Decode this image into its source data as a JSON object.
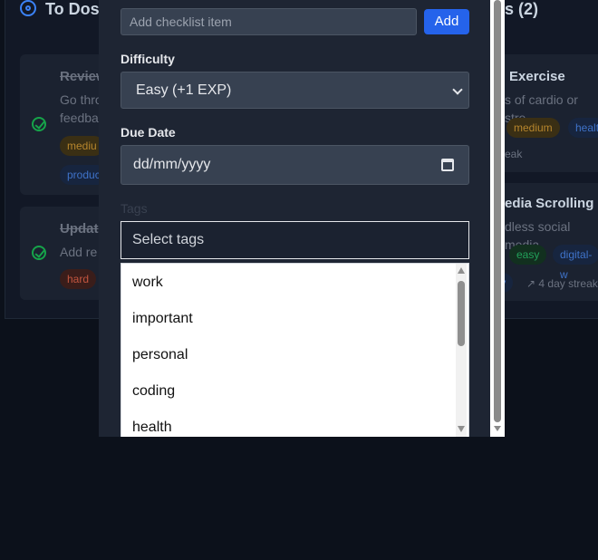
{
  "background": {
    "todos_header": "To Dos",
    "habits_header_tail": "s (2)",
    "cards_left": [
      {
        "title": "Review",
        "desc_line1": "Go thro",
        "desc_line2": "feedba",
        "chip1": "mediu",
        "chip2": "produc"
      },
      {
        "title": "Updat",
        "desc_line1": "Add re",
        "chip1": "hard"
      }
    ],
    "cards_right": [
      {
        "title": "Exercise",
        "desc": "s of cardio or stre",
        "chip1": "medium",
        "chip2": "healt",
        "streak": "eak"
      },
      {
        "title": "edia Scrolling",
        "desc": "dless social media",
        "chip1": "easy",
        "chip2": "digital-w",
        "chip3": "ty",
        "streak": "4 day streak"
      }
    ]
  },
  "modal": {
    "checklist": {
      "placeholder": "Add checklist item",
      "add_label": "Add"
    },
    "difficulty": {
      "label": "Difficulty",
      "selected": "Easy (+1 EXP)"
    },
    "due_date": {
      "label": "Due Date",
      "value": "dd/mm/yyyy"
    },
    "tags": {
      "label": "Tags",
      "placeholder": "Select tags",
      "options": [
        "work",
        "important",
        "personal",
        "coding",
        "health"
      ]
    }
  },
  "colors": {
    "accent": "#2563eb",
    "modal_bg": "#1e2533",
    "page_bg": "#0c111b"
  }
}
